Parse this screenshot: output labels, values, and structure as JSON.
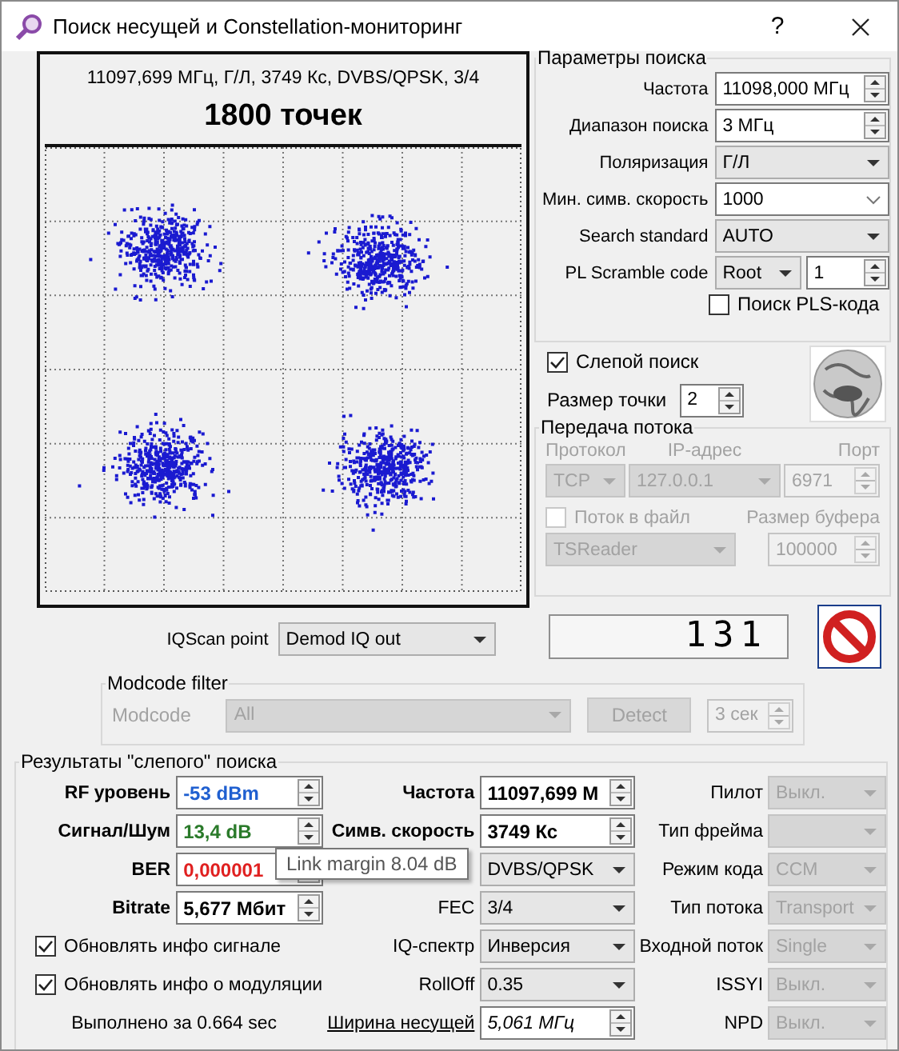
{
  "window": {
    "title": "Поиск несущей и Constellation-мониторинг",
    "help": "?"
  },
  "constellation": {
    "info": "11097,699 МГц, Г/Л, 3749 Кс, DVBS/QPSK, 3/4",
    "points": "1800 точек"
  },
  "search_params": {
    "title": "Параметры поиска",
    "fields": [
      {
        "label": "Частота",
        "kind": "spin",
        "value": "11098,000 МГц"
      },
      {
        "label": "Диапазон поиска",
        "kind": "spin",
        "value": "3 МГц"
      },
      {
        "label": "Поляризация",
        "kind": "combo",
        "value": "Г/Л"
      },
      {
        "label": "Мин. симв. скорость",
        "kind": "editcombo",
        "value": "1000"
      },
      {
        "label": "Search standard",
        "kind": "combo",
        "value": "AUTO"
      },
      {
        "label": "PL Scramble code",
        "kind": "pair",
        "value": "Root",
        "value2": "1"
      }
    ],
    "pls_search": {
      "label": "Поиск PLS-кода",
      "checked": false
    }
  },
  "blind_search": {
    "label": "Слепой поиск",
    "checked": true
  },
  "dot_size": {
    "label": "Размер точки",
    "value": "2"
  },
  "stream": {
    "title": "Передача потока",
    "disabled": true,
    "protocol_label": "Протокол",
    "ip_label": "IP-адрес",
    "port_label": "Порт",
    "protocol": "TCP",
    "ip": "127.0.0.1",
    "port": "6971",
    "to_file": {
      "label": "Поток в файл",
      "checked": false
    },
    "buffer_label": "Размер буфера",
    "reader": "TSReader",
    "buffer": "100000"
  },
  "counter": "131",
  "iqscan": {
    "label": "IQScan point",
    "value": "Demod IQ out"
  },
  "modcode_filter": {
    "title": "Modcode filter",
    "disabled": true,
    "label": "Modcode",
    "value": "All",
    "detect": "Detect",
    "interval": "3 сек"
  },
  "results": {
    "title": "Результаты \"слепого\" поиска",
    "left": [
      {
        "label": "RF уровень",
        "value": "-53 dBm",
        "color": "#1f5fd0"
      },
      {
        "label": "Сигнал/Шум",
        "value": "13,4 dB",
        "color": "#2a7a2a"
      },
      {
        "label": "BER",
        "value": "0,000001",
        "color": "#e02020"
      },
      {
        "label": "Bitrate",
        "value": "5,677 Мбит",
        "color": "#000000"
      }
    ],
    "checks": [
      {
        "label": "Обновлять инфо сигнале",
        "checked": true
      },
      {
        "label": "Обновлять инфо о модуляции",
        "checked": true
      }
    ],
    "elapsed": "Выполнено за 0.664 sec",
    "middle": [
      {
        "label": "Частота",
        "kind": "spin",
        "value": "11097,699 М",
        "disabled": false
      },
      {
        "label": "Симв. скорость",
        "kind": "spin",
        "value": "3749 Кс",
        "disabled": false
      },
      {
        "kind": "combo",
        "value": "DVBS/QPSK",
        "disabled": false
      },
      {
        "label": "FEC",
        "kind": "combo",
        "value": "3/4",
        "disabled": false
      },
      {
        "label": "IQ-спектр",
        "kind": "combo",
        "value": "Инверсия",
        "disabled": false
      },
      {
        "label": "RollOff",
        "kind": "combo",
        "value": "0.35",
        "disabled": false
      },
      {
        "label": "Ширина несущей",
        "kind": "link-spin",
        "value": "5,061 МГц",
        "disabled": false
      }
    ],
    "right": [
      {
        "label": "Пилот",
        "value": "Выкл.",
        "disabled": true
      },
      {
        "label": "Тип фрейма",
        "disabled": true
      },
      {
        "label": "Режим кода",
        "value": "CCM",
        "disabled": true
      },
      {
        "label": "Тип потока",
        "value": "Transport",
        "disabled": true
      },
      {
        "label": "Входной поток",
        "value": "Single",
        "disabled": true
      },
      {
        "label": "ISSYI",
        "value": "Выкл.",
        "disabled": true
      },
      {
        "label": "NPD",
        "value": "Выкл.",
        "disabled": true
      }
    ]
  },
  "tooltip": "Link margin 8.04 dB"
}
